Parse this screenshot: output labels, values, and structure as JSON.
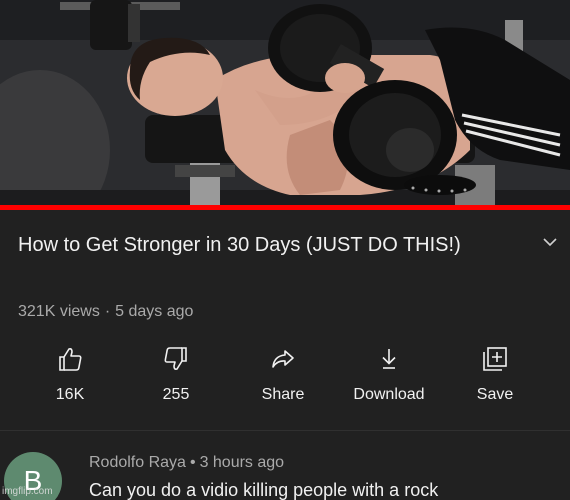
{
  "video": {
    "progress_fraction": 1.0,
    "progress_color": "#ff0000"
  },
  "title": "How to Get Stronger in 30 Days (JUST DO THIS!)",
  "meta": {
    "views": "321K views",
    "separator": "·",
    "age": "5 days ago"
  },
  "actions": {
    "like": {
      "label": "16K",
      "icon": "thumbs-up-icon"
    },
    "dislike": {
      "label": "255",
      "icon": "thumbs-down-icon"
    },
    "share": {
      "label": "Share",
      "icon": "share-arrow-icon"
    },
    "download": {
      "label": "Download",
      "icon": "download-arrow-icon"
    },
    "save": {
      "label": "Save",
      "icon": "add-to-playlist-icon"
    }
  },
  "comment": {
    "avatar_letter": "B",
    "avatar_color": "#5e8a6f",
    "author": "Rodolfo Raya",
    "separator": "•",
    "time": "3 hours ago",
    "text": "Can you do a vidio killing people  with a rock"
  },
  "watermark": "imgflip.com",
  "colors": {
    "background": "#212121",
    "primary_text": "#f1f1f1",
    "secondary_text": "#aaaaaa"
  }
}
